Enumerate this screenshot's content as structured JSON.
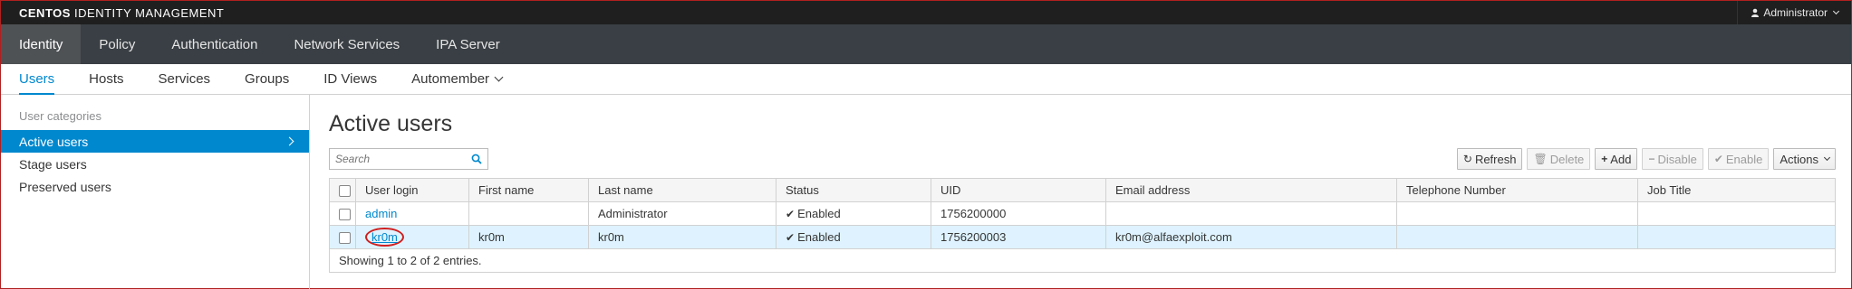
{
  "masthead": {
    "brand_bold": "CENTOS",
    "brand_rest": " IDENTITY MANAGEMENT",
    "user": "Administrator"
  },
  "primary_nav": [
    "Identity",
    "Policy",
    "Authentication",
    "Network Services",
    "IPA Server"
  ],
  "secondary_nav": [
    "Users",
    "Hosts",
    "Services",
    "Groups",
    "ID Views",
    "Automember"
  ],
  "sidebar": {
    "heading": "User categories",
    "items": [
      "Active users",
      "Stage users",
      "Preserved users"
    ]
  },
  "main": {
    "title": "Active users",
    "search_placeholder": "Search",
    "buttons": {
      "refresh": "Refresh",
      "delete": "Delete",
      "add": "Add",
      "disable": "Disable",
      "enable": "Enable",
      "actions": "Actions"
    }
  },
  "table": {
    "columns": [
      "User login",
      "First name",
      "Last name",
      "Status",
      "UID",
      "Email address",
      "Telephone Number",
      "Job Title"
    ],
    "rows": [
      {
        "login": "admin",
        "first": "",
        "last": "Administrator",
        "status": "Enabled",
        "uid": "1756200000",
        "email": "",
        "phone": "",
        "job": ""
      },
      {
        "login": "kr0m",
        "first": "kr0m",
        "last": "kr0m",
        "status": "Enabled",
        "uid": "1756200003",
        "email": "kr0m@alfaexploit.com",
        "phone": "",
        "job": ""
      }
    ],
    "footer": "Showing 1 to 2 of 2 entries."
  },
  "colors": {
    "accent": "#0088ce",
    "masthead": "#1f1f1f",
    "nav": "#393f44",
    "selected_row": "#def3ff",
    "annotation_circle": "#d01e1e"
  }
}
